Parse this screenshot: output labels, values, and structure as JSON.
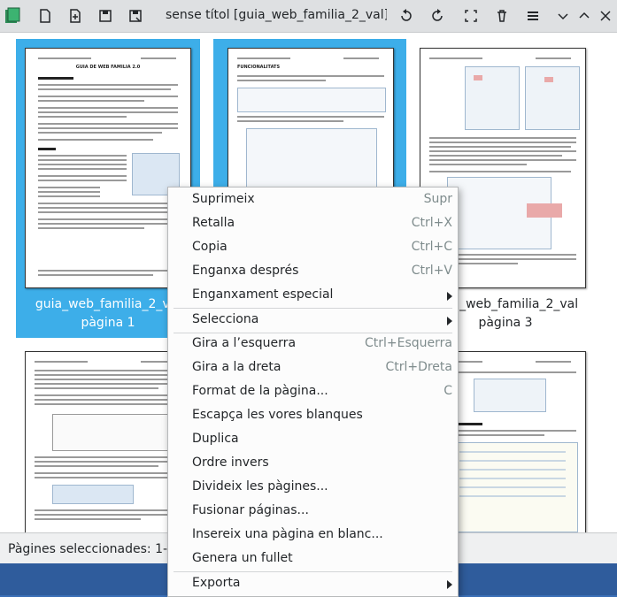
{
  "window": {
    "title": "sense títol [guia_web_familia_2_val] – ..."
  },
  "toolbar": {
    "left_icons": [
      "app-logo-icon",
      "new-document-icon",
      "add-page-icon",
      "save-icon",
      "save-as-icon"
    ],
    "right_icons": [
      "rotate-left-icon",
      "rotate-right-icon",
      "select-area-icon",
      "delete-icon",
      "hamburger-menu-icon",
      "minimize-chevron-icon",
      "maximize-chevron-icon",
      "close-icon"
    ]
  },
  "pages": [
    {
      "caption_line1": "guia_web_familia_2_val",
      "caption_line2": "pàgina 1",
      "selected": true
    },
    {
      "caption_line1": "",
      "caption_line2": "",
      "selected": true
    },
    {
      "caption_line1": "guia_web_familia_2_val",
      "caption_line2": "pàgina 3",
      "selected": false
    },
    {
      "caption_line1": "",
      "caption_line2": "",
      "selected": false
    },
    {
      "caption_line1": "",
      "caption_line2": "",
      "selected": false
    },
    {
      "caption_line1": "",
      "caption_line2": "",
      "selected": false
    }
  ],
  "page_text": {
    "p1_title": "GUIA DE WEB FAMILIA 2.0",
    "p2_title": "FUNCIONALITATS"
  },
  "status": {
    "text": "Pàgines seleccionades: 1-2 / 1"
  },
  "context_menu": {
    "items": [
      {
        "label": "Suprimeix",
        "shortcut": "Supr"
      },
      {
        "label": "Retalla",
        "shortcut": "Ctrl+X"
      },
      {
        "label": "Copia",
        "shortcut": "Ctrl+C"
      },
      {
        "label": "Enganxa després",
        "shortcut": "Ctrl+V"
      },
      {
        "label": "Enganxament especial",
        "shortcut": ""
      },
      {
        "label": "Selecciona",
        "shortcut": ""
      },
      {
        "label": "Gira a l’esquerra",
        "shortcut": "Ctrl+Esquerra"
      },
      {
        "label": "Gira a la dreta",
        "shortcut": "Ctrl+Dreta"
      },
      {
        "label": "Format de la pàgina...",
        "shortcut": "C"
      },
      {
        "label": "Escapça les vores blanques",
        "shortcut": ""
      },
      {
        "label": "Duplica",
        "shortcut": ""
      },
      {
        "label": "Ordre invers",
        "shortcut": ""
      },
      {
        "label": "Divideix les pàgines...",
        "shortcut": ""
      },
      {
        "label": "Fusionar páginas...",
        "shortcut": ""
      },
      {
        "label": "Insereix una pàgina en blanc...",
        "shortcut": ""
      },
      {
        "label": "Genera un fullet",
        "shortcut": ""
      },
      {
        "label": "Exporta",
        "shortcut": ""
      }
    ]
  },
  "colors": {
    "selection": "#3daee9",
    "menu_bg": "#fcfcfc",
    "shortcut_text": "#7f8c8d"
  }
}
